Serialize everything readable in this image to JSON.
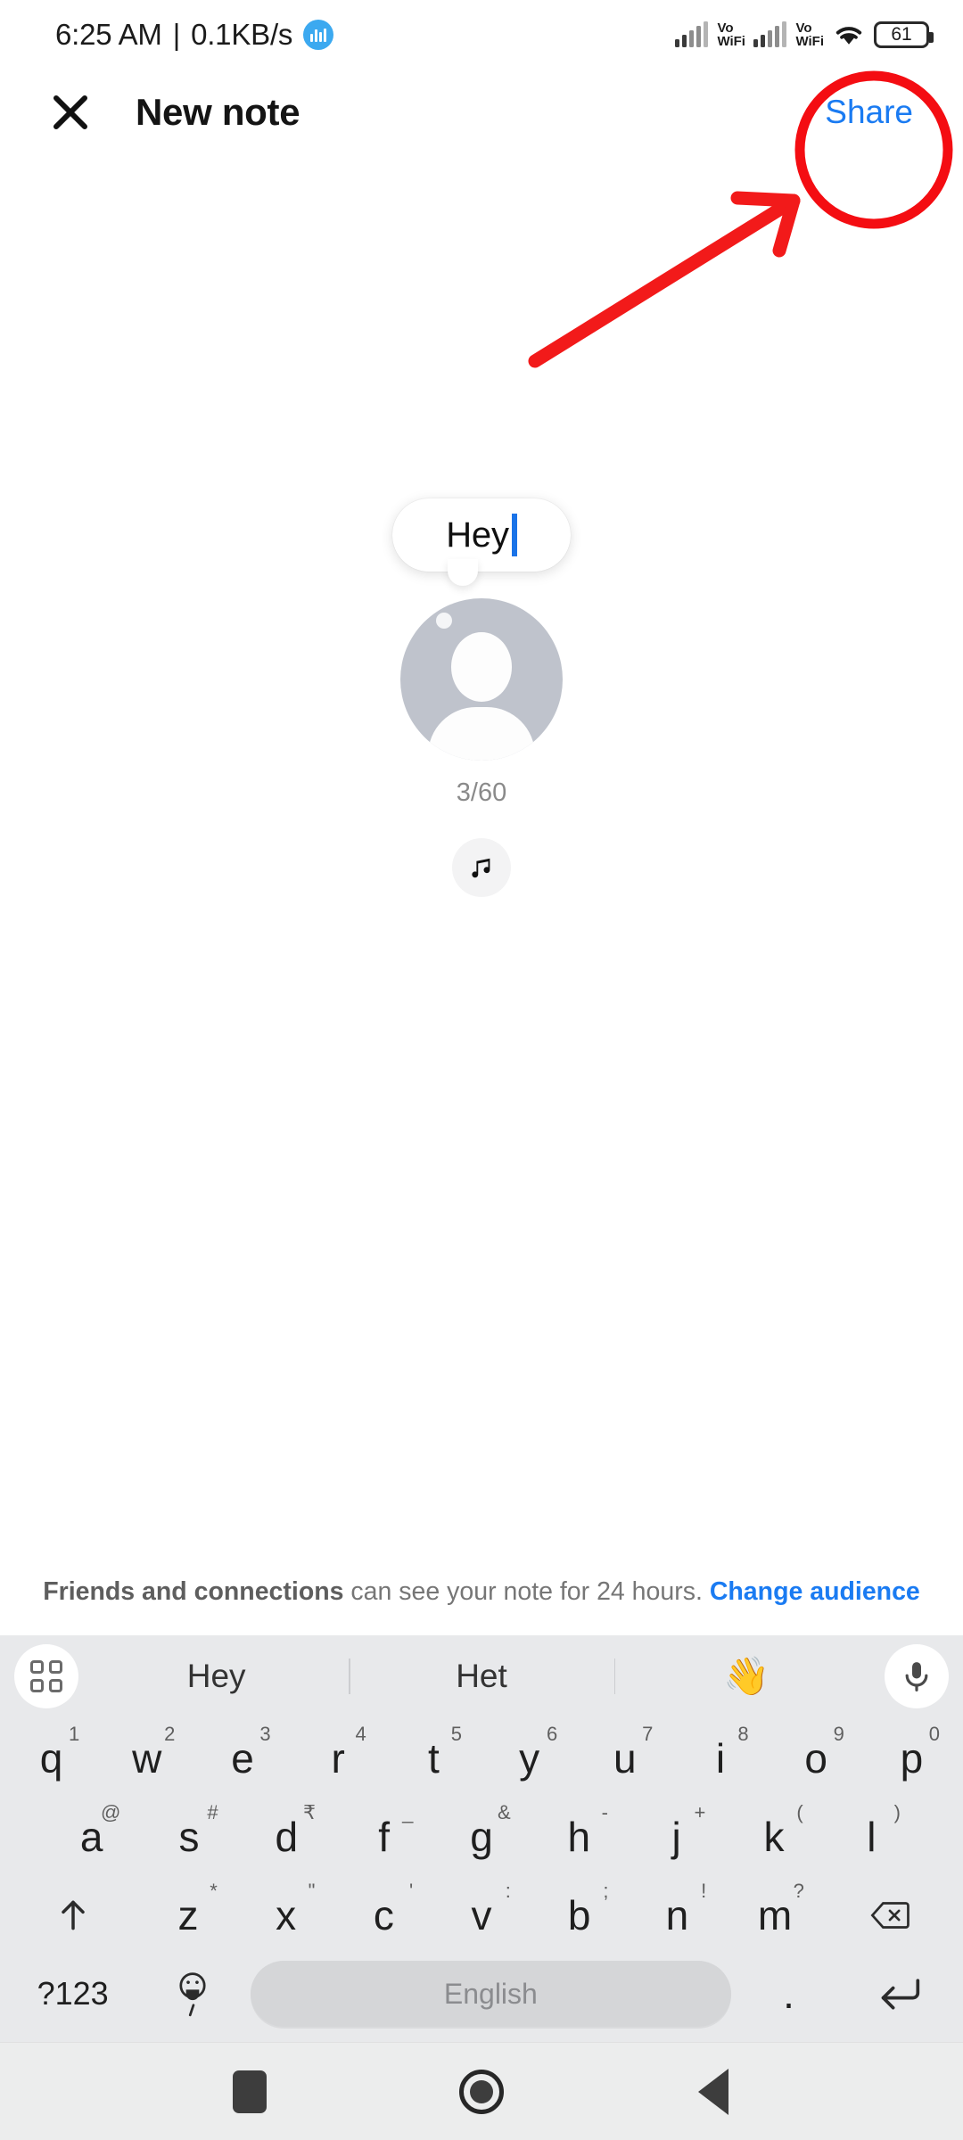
{
  "status_bar": {
    "time": "6:25 AM",
    "separator": "|",
    "data_rate": "0.1KB/s",
    "data_badge_icon": "data-usage-badge-icon",
    "signal_1_icon": "cellular-signal-icon",
    "vowifi_1_line1": "Vo",
    "vowifi_1_line2": "WiFi",
    "signal_2_icon": "cellular-signal-icon",
    "vowifi_2_line1": "Vo",
    "vowifi_2_line2": "WiFi",
    "wifi_icon": "wifi-icon",
    "battery_level": "61"
  },
  "header": {
    "close_icon": "close-icon",
    "title": "New note",
    "share_label": "Share"
  },
  "annotations": {
    "highlight_circle_color": "#f40d12",
    "arrow_color": "#f21a1a",
    "target": "share-button"
  },
  "composer": {
    "note_text": "Hey",
    "char_counter": "3/60",
    "avatar_icon": "default-avatar-icon",
    "music_icon": "music-note-icon"
  },
  "audience": {
    "audience_name": "Friends and connections",
    "description": " can see your note for 24 hours. ",
    "change_link": "Change audience"
  },
  "keyboard": {
    "grid_icon": "grid-menu-icon",
    "mic_icon": "microphone-icon",
    "suggestions": [
      {
        "label": "Hey",
        "type": "word"
      },
      {
        "label": "Het",
        "type": "word"
      },
      {
        "label": "👋",
        "type": "emoji"
      }
    ],
    "rows": [
      [
        {
          "main": "q",
          "alt": "1"
        },
        {
          "main": "w",
          "alt": "2"
        },
        {
          "main": "e",
          "alt": "3"
        },
        {
          "main": "r",
          "alt": "4"
        },
        {
          "main": "t",
          "alt": "5"
        },
        {
          "main": "y",
          "alt": "6"
        },
        {
          "main": "u",
          "alt": "7"
        },
        {
          "main": "i",
          "alt": "8"
        },
        {
          "main": "o",
          "alt": "9"
        },
        {
          "main": "p",
          "alt": "0"
        }
      ],
      [
        {
          "main": "a",
          "alt": "@"
        },
        {
          "main": "s",
          "alt": "#"
        },
        {
          "main": "d",
          "alt": "₹"
        },
        {
          "main": "f",
          "alt": "_"
        },
        {
          "main": "g",
          "alt": "&"
        },
        {
          "main": "h",
          "alt": "-"
        },
        {
          "main": "j",
          "alt": "+"
        },
        {
          "main": "k",
          "alt": "("
        },
        {
          "main": "l",
          "alt": ")"
        }
      ],
      [
        {
          "main": "z",
          "alt": "*"
        },
        {
          "main": "x",
          "alt": "\""
        },
        {
          "main": "c",
          "alt": "'"
        },
        {
          "main": "v",
          "alt": ":"
        },
        {
          "main": "b",
          "alt": ";"
        },
        {
          "main": "n",
          "alt": "!"
        },
        {
          "main": "m",
          "alt": "?"
        }
      ]
    ],
    "shift_icon": "shift-arrow-icon",
    "backspace_icon": "backspace-icon",
    "symbols_key": "?123",
    "emoji_key_icon": "emoji-smiley-icon",
    "emoji_key_alt": ",",
    "space_label": "English",
    "period_key": ".",
    "enter_icon": "enter-return-icon"
  },
  "nav_bar": {
    "recents_icon": "recents-square-icon",
    "home_icon": "home-circle-icon",
    "back_icon": "back-triangle-icon"
  }
}
